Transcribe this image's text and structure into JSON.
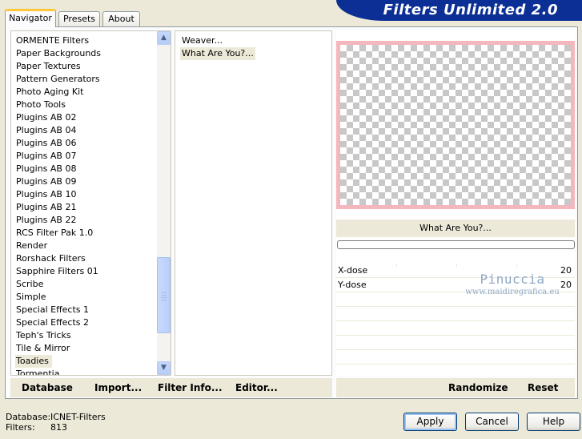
{
  "window": {
    "title": "Filters Unlimited 2.0"
  },
  "tabs": [
    {
      "label": "Navigator"
    },
    {
      "label": "Presets"
    },
    {
      "label": "About"
    }
  ],
  "categories": {
    "items": [
      "ORMENTE Filters",
      "Paper Backgrounds",
      "Paper Textures",
      "Pattern Generators",
      "Photo Aging Kit",
      "Photo Tools",
      "Plugins AB 02",
      "Plugins AB 04",
      "Plugins AB 06",
      "Plugins AB 07",
      "Plugins AB 08",
      "Plugins AB 09",
      "Plugins AB 10",
      "Plugins AB 21",
      "Plugins AB 22",
      "RCS Filter Pak 1.0",
      "Render",
      "Rorshack Filters",
      "Sapphire Filters 01",
      "Scribe",
      "Simple",
      "Special Effects 1",
      "Special Effects 2",
      "Teph's Tricks",
      "Tile & Mirror",
      "Toadies",
      "Tormentia"
    ],
    "selected": "Toadies"
  },
  "filters": {
    "items": [
      "Weaver...",
      "What Are You?..."
    ],
    "selected": "What Are You?..."
  },
  "preview": {
    "filter_name": "What Are You?...",
    "border_color": "#f4b7bd"
  },
  "params": [
    {
      "name": "X-dose",
      "value": "20"
    },
    {
      "name": "Y-dose",
      "value": "20"
    }
  ],
  "watermark": {
    "name": "Pinuccia",
    "url": "www.maidiregrafica.eu"
  },
  "left_buttons": {
    "database": "Database",
    "import": "Import...",
    "filter_info": "Filter Info...",
    "editor": "Editor..."
  },
  "right_buttons": {
    "randomize": "Randomize",
    "reset": "Reset"
  },
  "status": {
    "database_label": "Database:",
    "database_value": "ICNET-Filters",
    "filters_label": "Filters:",
    "filters_value": "813"
  },
  "dialog": {
    "apply": "Apply",
    "cancel": "Cancel",
    "help": "Help"
  },
  "colors": {
    "banner": "#0b2f94",
    "tab_accent": "#ffc83c",
    "background": "#ece9d8"
  }
}
